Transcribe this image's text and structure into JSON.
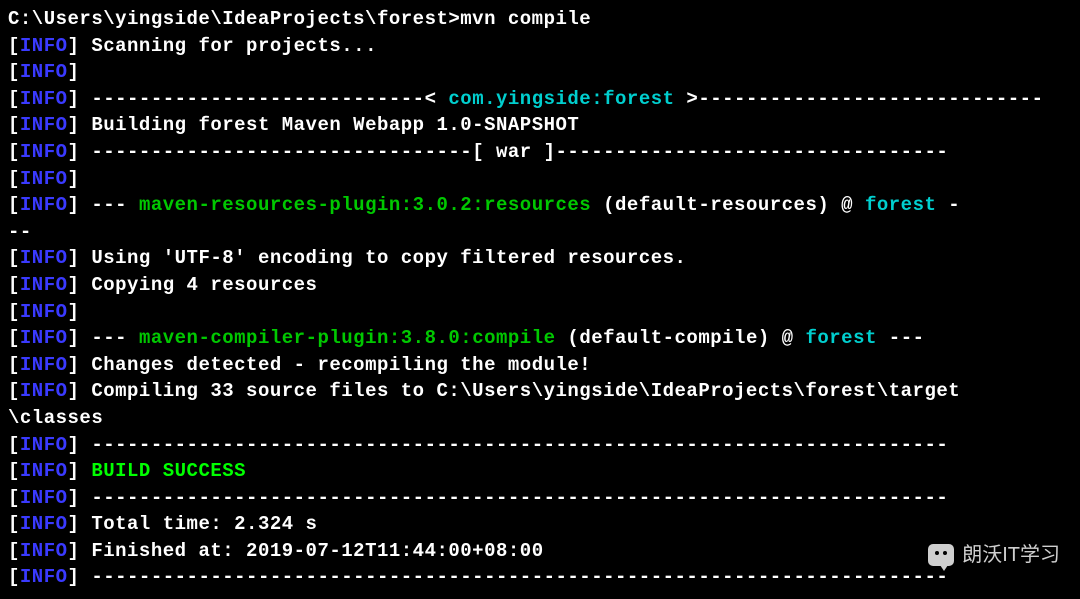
{
  "prompt": "C:\\Users\\yingside\\IdeaProjects\\forest>mvn compile",
  "info_tag": "INFO",
  "bracket_open": "[",
  "bracket_close": "]",
  "scan": " Scanning for projects...",
  "dash_pre_project": " ----------------------------< ",
  "project_id": "com.yingside:forest",
  "dash_post_project": " >-----------------------------",
  "building": " Building forest Maven Webapp 1.0-SNAPSHOT",
  "dash_pre_war": " --------------------------------",
  "war_label": "[ war ]",
  "dash_post_war": "---------------------------------",
  "plugin_dash_pre": " --- ",
  "resources_plugin": "maven-resources-plugin:3.0.2:resources",
  "resources_phase": " (default-resources) @ ",
  "project_name": "forest",
  "plugin_dash_post": " -",
  "cont_dashes": "--",
  "utf8": " Using 'UTF-8' encoding to copy filtered resources.",
  "copying": " Copying 4 resources",
  "compiler_plugin": "maven-compiler-plugin:3.8.0:compile",
  "compiler_phase": " (default-compile) @ ",
  "compiler_dash_post": " ---",
  "changes": " Changes detected - recompiling the module!",
  "compiling": " Compiling 33 source files to C:\\Users\\yingside\\IdeaProjects\\forest\\target",
  "classes_cont": "\\classes",
  "long_dash": " ------------------------------------------------------------------------",
  "build_success": " BUILD SUCCESS",
  "total_time": " Total time: 2.324 s",
  "finished_at": " Finished at: 2019-07-12T11:44:00+08:00",
  "watermark_text": "朗沃IT学习"
}
